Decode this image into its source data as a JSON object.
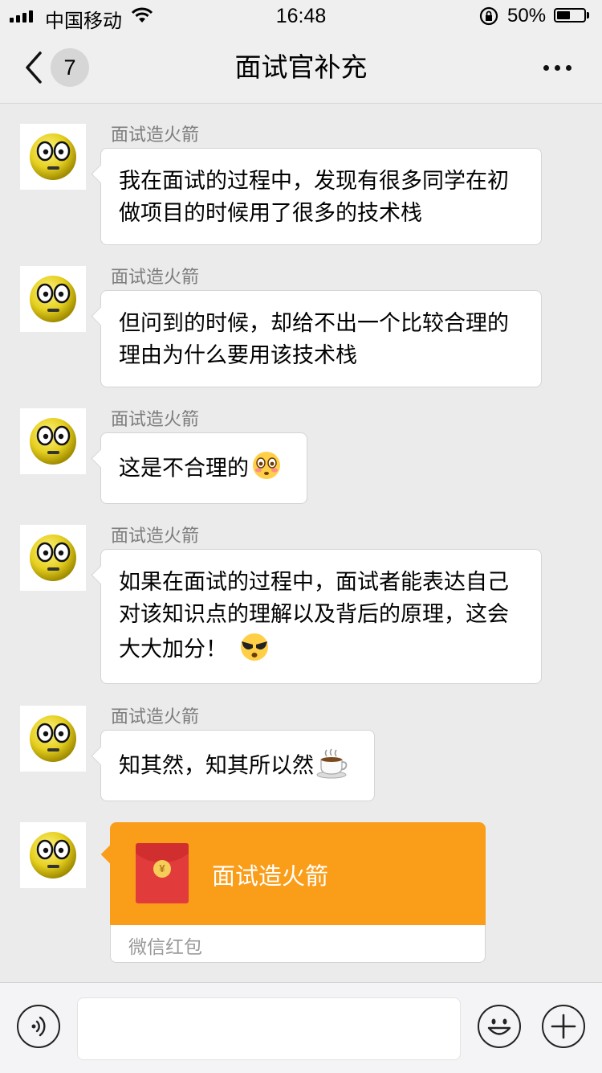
{
  "status_bar": {
    "carrier": "中国移动",
    "time": "16:48",
    "battery_percent": "50%",
    "battery_level": 0.5
  },
  "nav": {
    "unread_count": "7",
    "title": "面试官补充",
    "back_icon": "chevron-left-icon",
    "more_icon": "more-dots-icon"
  },
  "messages": [
    {
      "sender": "面试造火箭",
      "lines": [
        "我在面试的过程中，发现有很多同学在初",
        "做项目的时候用了很多的技术栈"
      ]
    },
    {
      "sender": "面试造火箭",
      "lines": [
        "但问到的时候，却给不出一个比较合理的",
        "理由为什么要用该技术栈"
      ]
    },
    {
      "sender": "面试造火箭",
      "lines": [
        "这是不合理的"
      ],
      "emoji": "flushed-face-emoji"
    },
    {
      "sender": "面试造火箭",
      "lines": [
        "如果在面试的过程中，面试者能表达自己",
        "对该知识点的理解以及背后的原理，这会",
        "大大加分！"
      ],
      "emoji": "sunglasses-face-emoji"
    },
    {
      "sender": "面试造火箭",
      "lines": [
        "知其然，知其所以然"
      ],
      "emoji": "hot-coffee-emoji"
    }
  ],
  "red_packet": {
    "title": "面试造火箭",
    "label": "微信红包",
    "coin_symbol": "¥"
  },
  "input_bar": {
    "voice_icon": "voice-icon",
    "emoji_icon": "emoji-face-icon",
    "add_icon": "plus-icon"
  },
  "colors": {
    "background": "#ebebeb",
    "red_packet": "#fa9d19",
    "envelope": "#e23b3b"
  }
}
